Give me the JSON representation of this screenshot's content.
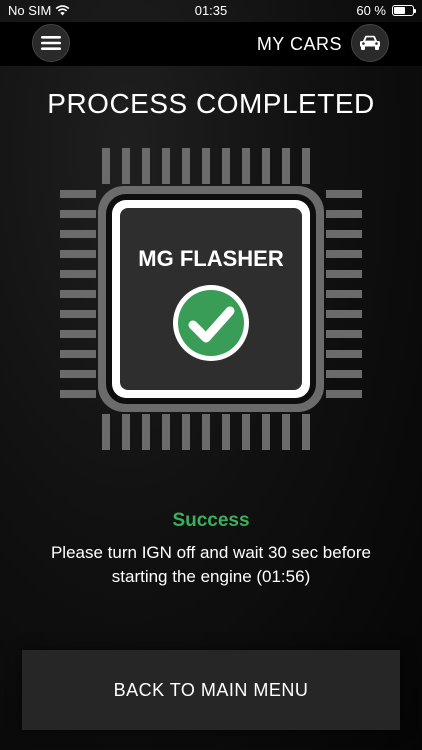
{
  "statusbar": {
    "carrier": "No SIM",
    "time": "01:35",
    "battery_percent": "60 %",
    "battery_level": 0.6
  },
  "navbar": {
    "menu_icon": "hamburger-menu-icon",
    "my_cars_label": "MY CARS",
    "car_icon": "car-icon"
  },
  "page": {
    "title": "PROCESS COMPLETED"
  },
  "chip": {
    "label": "MG FLASHER",
    "icon": "checkmark-icon",
    "check_color": "#3a9d57"
  },
  "status": {
    "success_label": "Success",
    "message_line1": "Please turn IGN off and wait 30 sec before",
    "message_line2": "starting the engine (01:56)",
    "success_color": "#3cae5c"
  },
  "actions": {
    "main_menu_label": "BACK TO MAIN MENU"
  }
}
